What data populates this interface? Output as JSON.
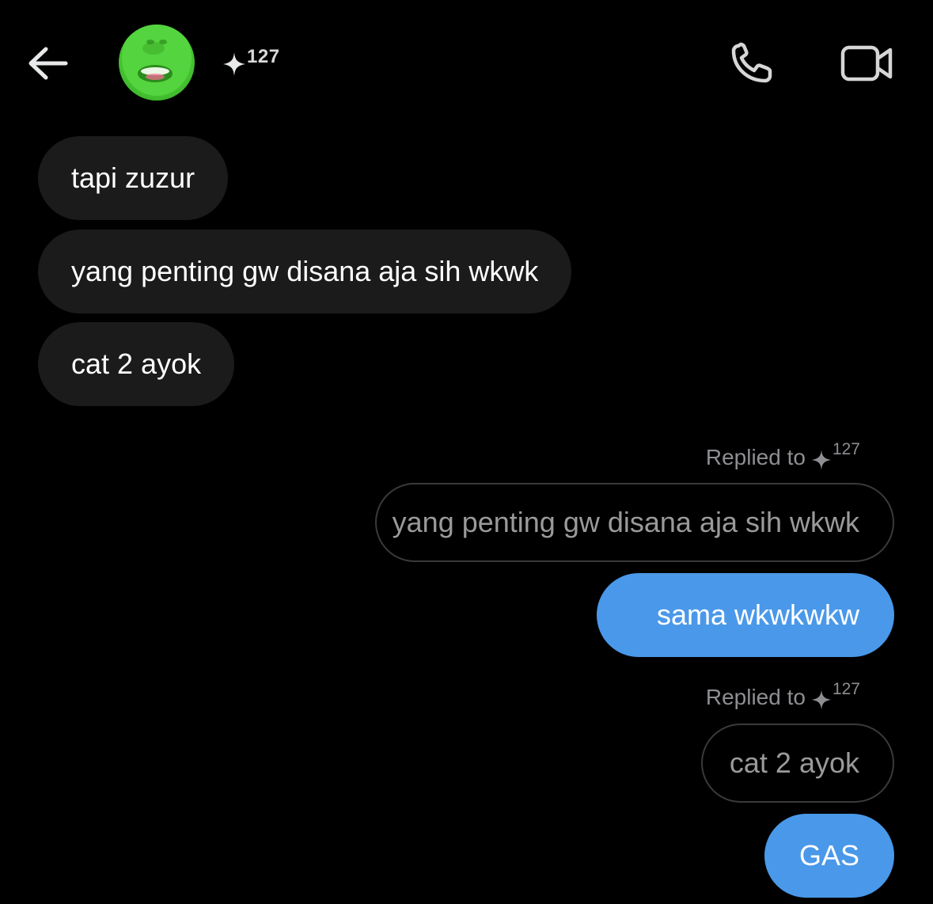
{
  "header": {
    "contact_number": "127",
    "back_icon": "arrow-left-icon",
    "star_icon": "sparkle-icon",
    "call_icon": "phone-icon",
    "video_icon": "video-camera-icon"
  },
  "messages": {
    "incoming": [
      "tapi zuzur",
      "yang penting gw disana aja sih wkwk",
      "cat 2 ayok"
    ],
    "replies": [
      {
        "replied_to_label": "Replied to",
        "replied_to_number": "127",
        "quoted_text": "yang penting gw disana aja sih wkwk",
        "message": "sama wkwkwkw"
      },
      {
        "replied_to_label": "Replied to",
        "replied_to_number": "127",
        "quoted_text": "cat 2 ayok",
        "message": "GAS"
      }
    ]
  },
  "colors": {
    "background": "#000000",
    "incoming_bubble": "#1b1b1c",
    "outgoing_bubble": "#4a98e9",
    "quoted_border": "#3a3a3c",
    "muted_text": "#8e8e93"
  }
}
